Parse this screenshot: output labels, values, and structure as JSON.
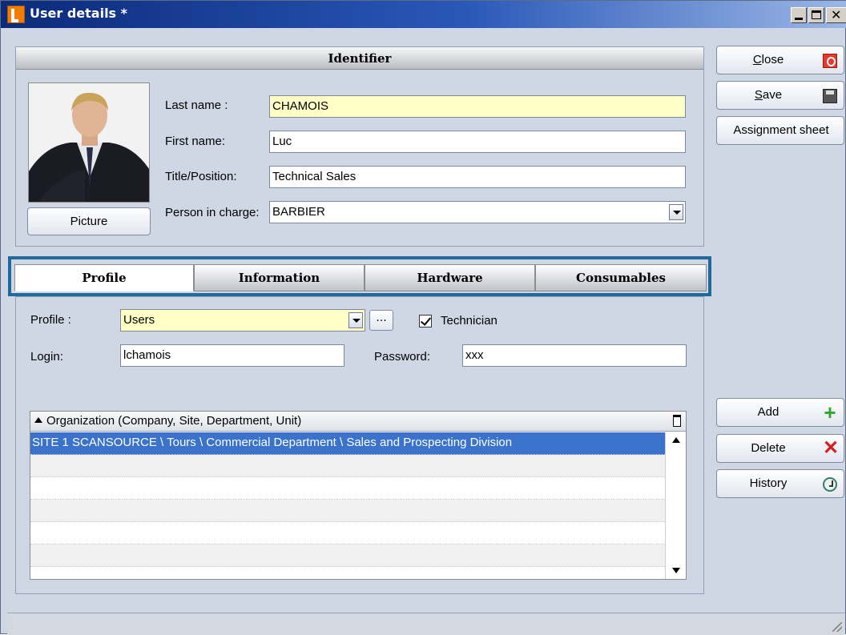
{
  "window": {
    "title": "User details *"
  },
  "identifier": {
    "header": "Identifier",
    "picture_button": "Picture",
    "last_name_label": "Last name :",
    "last_name_value": "CHAMOIS",
    "first_name_label": "First name:",
    "first_name_value": "Luc",
    "title_label": "Title/Position:",
    "title_value": "Technical Sales",
    "person_in_charge_label": "Person in charge:",
    "person_in_charge_value": "BARBIER"
  },
  "tabs": [
    {
      "label": "Profile",
      "active": true
    },
    {
      "label": "Information",
      "active": false
    },
    {
      "label": "Hardware",
      "active": false
    },
    {
      "label": "Consumables",
      "active": false
    }
  ],
  "profile": {
    "profile_label": "Profile :",
    "profile_value": "Users",
    "browse_button": "...",
    "technician_label": "Technician",
    "technician_checked": true,
    "login_label": "Login:",
    "login_value": "lchamois",
    "password_label": "Password:",
    "password_value": "xxx"
  },
  "organization_table": {
    "header": "Organization (Company, Site, Department, Unit)",
    "rows": [
      "SITE 1 SCANSOURCE \\ Tours \\ Commercial Department \\ Sales and Prospecting Division",
      "",
      "",
      "",
      "",
      "",
      ""
    ],
    "selected_row": 0
  },
  "side_buttons": {
    "close": {
      "label": "Close",
      "accel": "C",
      "rest": "lose",
      "icon": "close-power-icon"
    },
    "save": {
      "label": "Save",
      "accel": "S",
      "rest": "ave",
      "icon": "floppy-disk-icon"
    },
    "assignment": {
      "label": "Assignment sheet"
    },
    "add": {
      "label": "Add",
      "icon": "plus-icon"
    },
    "delete": {
      "label": "Delete",
      "icon": "x-icon"
    },
    "history": {
      "label": "History",
      "icon": "history-clock-icon"
    }
  },
  "colors": {
    "title_bar": "#0b2a7a",
    "selected_row": "#3a73c9",
    "tabs_highlight": "#1f6a9a",
    "required_field": "#ffffc6"
  }
}
